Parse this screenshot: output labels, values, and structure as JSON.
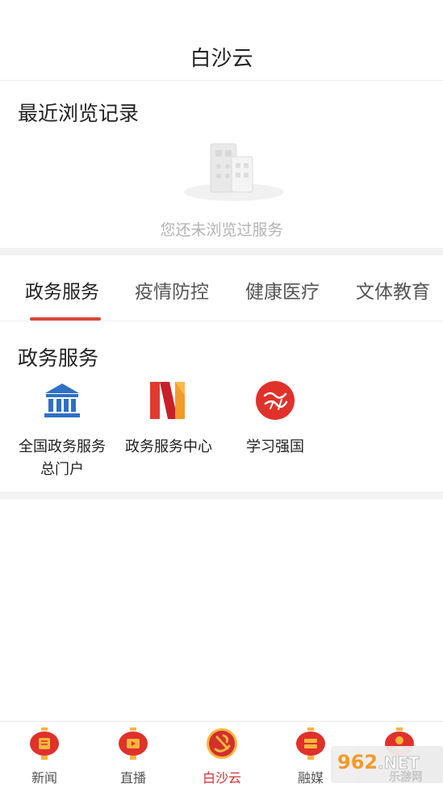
{
  "app": {
    "title": "白沙云"
  },
  "recent": {
    "heading": "最近浏览记录",
    "empty_text": "您还未浏览过服务"
  },
  "tabs": [
    {
      "label": "政务服务",
      "active": true
    },
    {
      "label": "疫情防控",
      "active": false
    },
    {
      "label": "健康医疗",
      "active": false
    },
    {
      "label": "文体教育",
      "active": false
    }
  ],
  "section": {
    "title": "政务服务"
  },
  "services": [
    {
      "label": "全国政务服务总门户",
      "icon": "government-building-icon"
    },
    {
      "label": "政务服务中心",
      "icon": "n-logo-icon"
    },
    {
      "label": "学习强国",
      "icon": "xuexi-qiangguo-icon"
    }
  ],
  "bottom_nav": [
    {
      "label": "新闻",
      "icon": "lantern-news-icon",
      "active": false
    },
    {
      "label": "直播",
      "icon": "lantern-live-icon",
      "active": false
    },
    {
      "label": "白沙云",
      "icon": "party-emblem-icon",
      "active": true
    },
    {
      "label": "融媒",
      "icon": "lantern-media-icon",
      "active": false
    },
    {
      "label": "",
      "icon": "lantern-profile-icon",
      "active": false
    }
  ],
  "watermark": {
    "text": "962.NET 乐游网",
    "logo_text": "乐游网"
  },
  "colors": {
    "accent": "#d9473b",
    "active_nav": "#d32f2f",
    "service_blue": "#2f6fc4",
    "lantern_red": "#e0312b",
    "lantern_gold": "#f6b73c",
    "empty_text": "#b3b3b3",
    "separator": "#f2f2f2"
  }
}
